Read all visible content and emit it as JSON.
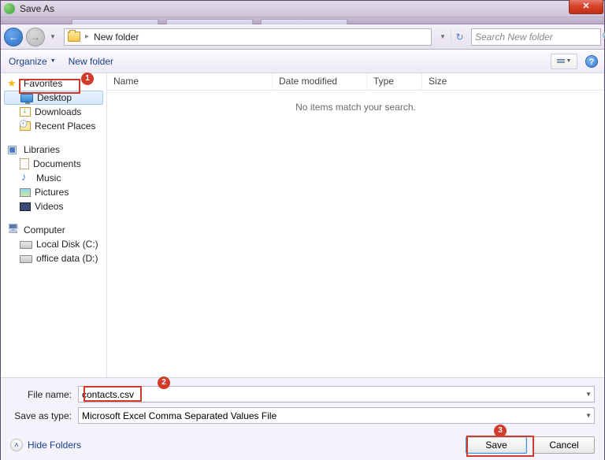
{
  "title": "Save As",
  "nav": {
    "path": "New folder",
    "search_placeholder": "Search New folder"
  },
  "toolbar": {
    "organize": "Organize",
    "newfolder": "New folder"
  },
  "sidebar": {
    "favorites": {
      "label": "Favorites",
      "items": [
        {
          "label": "Desktop",
          "selected": true
        },
        {
          "label": "Downloads"
        },
        {
          "label": "Recent Places"
        }
      ]
    },
    "libraries": {
      "label": "Libraries",
      "items": [
        {
          "label": "Documents"
        },
        {
          "label": "Music"
        },
        {
          "label": "Pictures"
        },
        {
          "label": "Videos"
        }
      ]
    },
    "computer": {
      "label": "Computer",
      "items": [
        {
          "label": "Local Disk (C:)"
        },
        {
          "label": "office data (D:)"
        }
      ]
    }
  },
  "columns": {
    "name": "Name",
    "date": "Date modified",
    "type": "Type",
    "size": "Size"
  },
  "empty_message": "No items match your search.",
  "form": {
    "filename_label": "File name:",
    "filename_value": "contacts.csv",
    "savetype_label": "Save as type:",
    "savetype_value": "Microsoft Excel Comma Separated Values File"
  },
  "footer": {
    "hidefolders": "Hide Folders",
    "save": "Save",
    "cancel": "Cancel"
  },
  "annotations": {
    "b1": "1",
    "b2": "2",
    "b3": "3"
  }
}
